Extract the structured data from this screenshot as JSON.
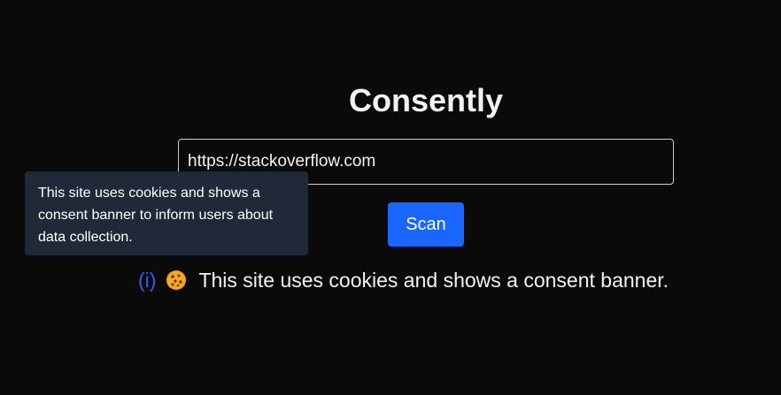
{
  "app": {
    "title": "Consently"
  },
  "scan_form": {
    "url_value": "https://stackoverflow.com",
    "scan_label": "Scan"
  },
  "result": {
    "info_label": "(i)",
    "icon": "cookie-icon",
    "message": "This site uses cookies and shows a consent banner."
  },
  "tooltip": {
    "text": "This site uses cookies and shows a consent banner to inform users about data collection."
  },
  "colors": {
    "background": "#0a0a0a",
    "accent": "#1a66ff",
    "info_link": "#2f5ef0",
    "tooltip_bg": "#1f2937"
  }
}
